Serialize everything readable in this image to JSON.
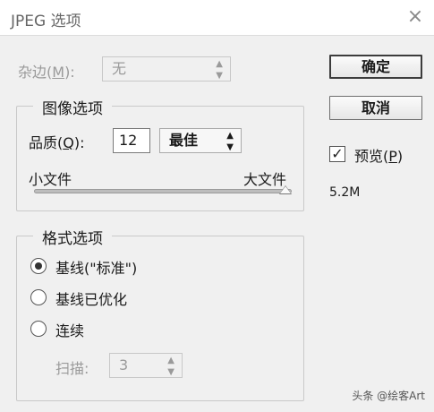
{
  "window": {
    "title": "JPEG 选项",
    "close_glyph": "×"
  },
  "matte": {
    "label": "杂边(",
    "key": "M",
    "suffix": "):",
    "value": "无"
  },
  "image_options": {
    "legend": "图像选项",
    "quality_label": "品质(",
    "quality_key": "Q",
    "quality_suffix": "):",
    "quality_value": "12",
    "quality_preset": "最佳",
    "small_file": "小文件",
    "large_file": "大文件",
    "slider_level": 1.0
  },
  "format_options": {
    "legend": "格式选项",
    "baseline_standard": "基线(\"标准\")",
    "baseline_optimized": "基线已优化",
    "progressive": "连续",
    "scans_label": "扫描:",
    "scans_value": "3",
    "selected": "baseline_standard"
  },
  "buttons": {
    "ok": "确定",
    "cancel": "取消"
  },
  "preview": {
    "label": "预览(",
    "key": "P",
    "suffix": ")",
    "checked": true,
    "check_glyph": "✓"
  },
  "file_size": "5.2M",
  "watermark": "头条 @绘客Art",
  "colors": {
    "background": "#f0f0f0",
    "disabled_text": "#9a9a9a"
  }
}
